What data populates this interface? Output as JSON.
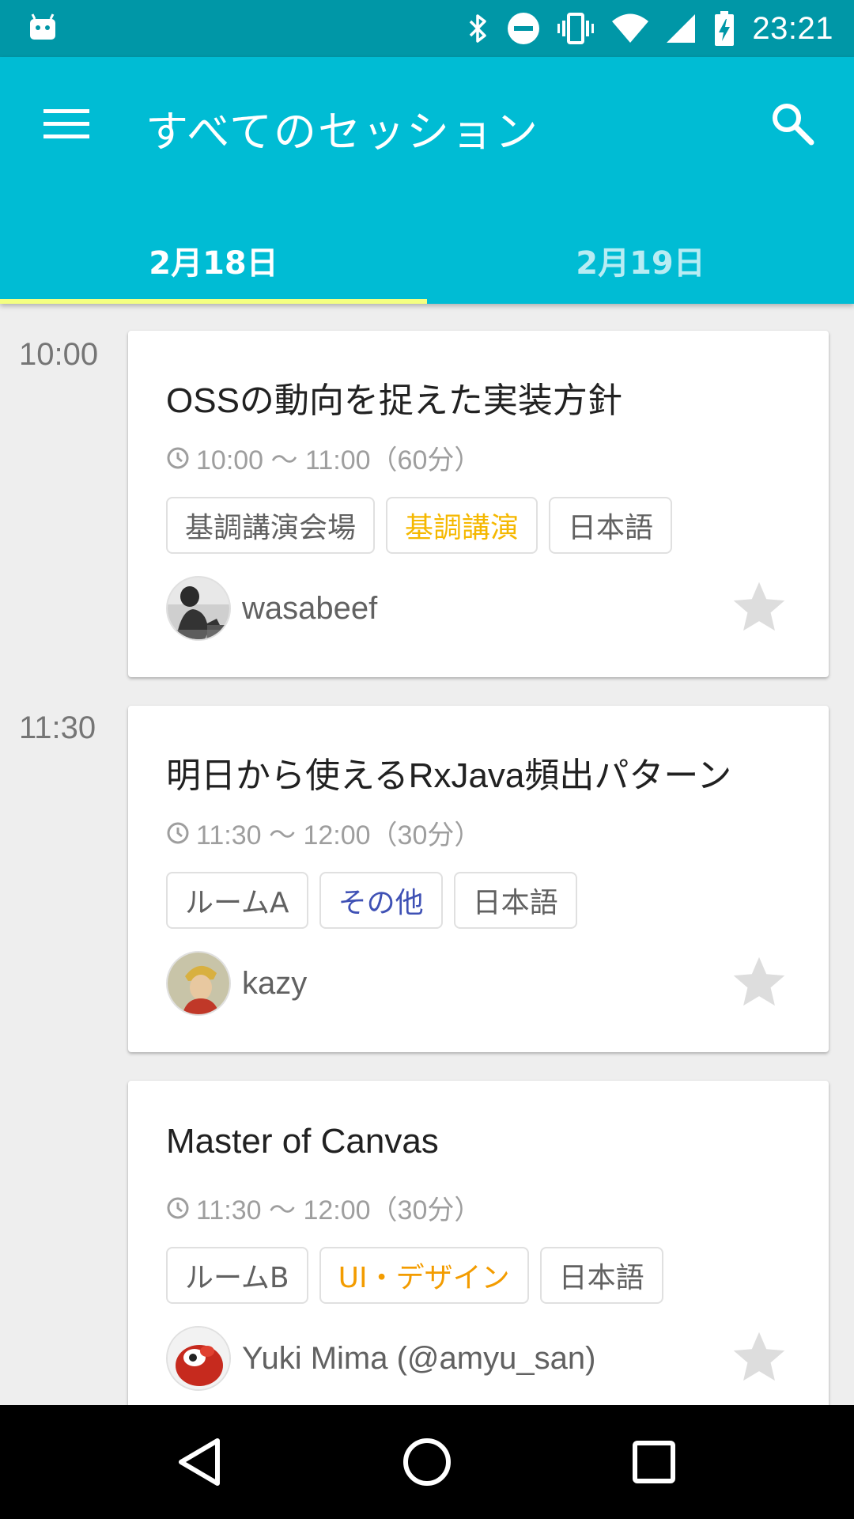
{
  "status_bar": {
    "clock": "23:21",
    "icons": [
      "android-debug-icon",
      "bluetooth-icon",
      "do-not-disturb-icon",
      "vibrate-icon",
      "wifi-icon",
      "signal-icon",
      "battery-charging-icon"
    ]
  },
  "app_bar": {
    "title": "すべてのセッション",
    "menu_icon": "menu-icon",
    "search_icon": "search-icon"
  },
  "tabs": [
    {
      "label": "2月18日",
      "selected": true
    },
    {
      "label": "2月19日",
      "selected": false
    }
  ],
  "colors": {
    "primary": "#00bcd4",
    "primary_dark": "#0097a7",
    "tab_indicator": "#f4ff81",
    "star_inactive": "#dddddd",
    "tag_keynote": "#f5b800",
    "tag_other": "#3f51b5",
    "tag_design": "#f39c00"
  },
  "sessions": [
    {
      "time_label": "10:00",
      "title": "OSSの動向を捉えた実装方針",
      "time_range": "10:00 〜 11:00（60分）",
      "tags": [
        {
          "label": "基調講演会場",
          "color": "#616161"
        },
        {
          "label": "基調講演",
          "color": "#f5b800"
        },
        {
          "label": "日本語",
          "color": "#616161"
        }
      ],
      "speaker": "wasabeef",
      "starred": false
    },
    {
      "time_label": "11:30",
      "title": "明日から使えるRxJava頻出パターン",
      "time_range": "11:30 〜 12:00（30分）",
      "tags": [
        {
          "label": "ルームA",
          "color": "#616161"
        },
        {
          "label": "その他",
          "color": "#3f51b5"
        },
        {
          "label": "日本語",
          "color": "#616161"
        }
      ],
      "speaker": "kazy",
      "starred": false
    },
    {
      "time_label": "",
      "title": "Master of Canvas",
      "time_range": "11:30 〜 12:00（30分）",
      "tags": [
        {
          "label": "ルームB",
          "color": "#616161"
        },
        {
          "label": "UI・デザイン",
          "color": "#f39c00"
        },
        {
          "label": "日本語",
          "color": "#616161"
        }
      ],
      "speaker": "Yuki Mima (@amyu_san)",
      "starred": false
    }
  ],
  "nav_bar": {
    "icons": [
      "back-icon",
      "home-icon",
      "recents-icon"
    ]
  }
}
